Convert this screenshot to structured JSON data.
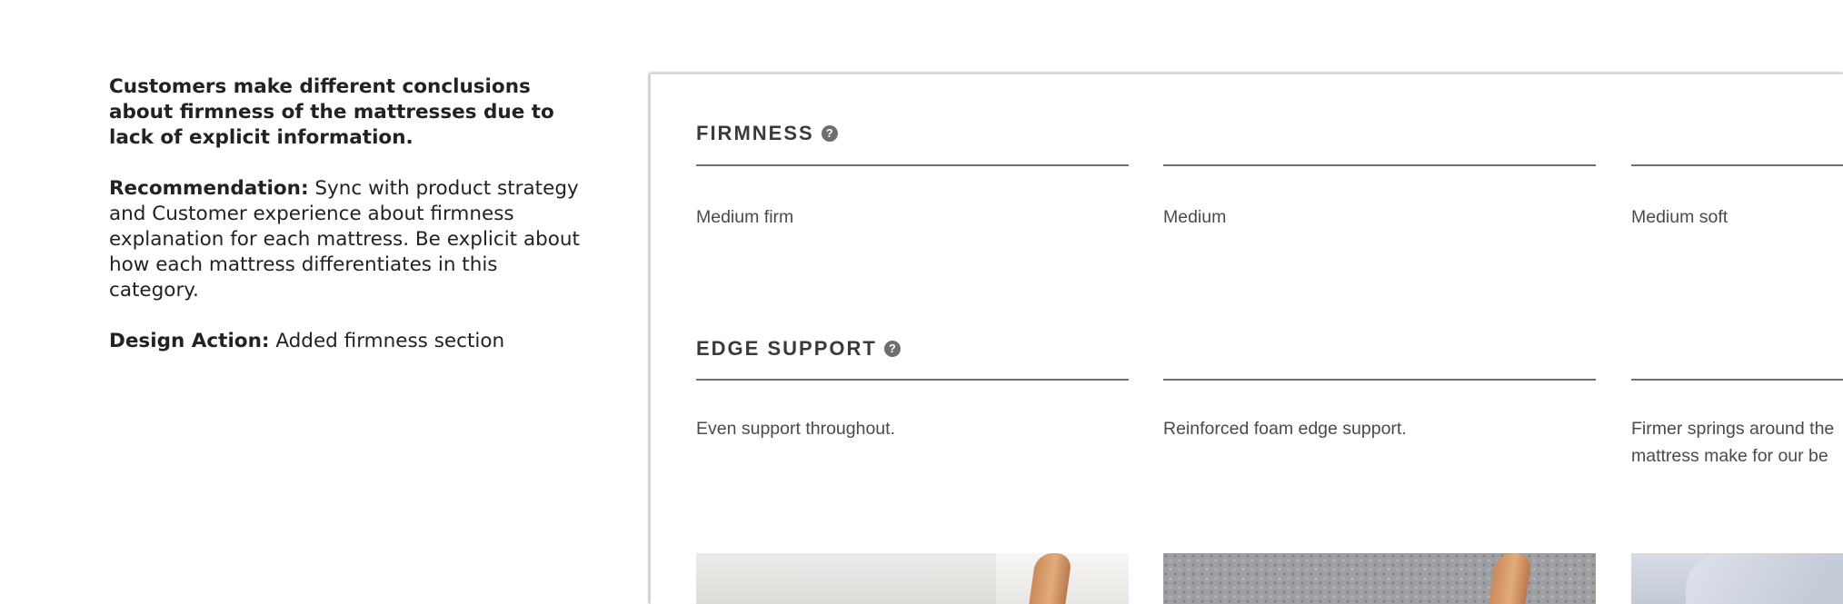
{
  "notes": {
    "finding": "Customers make different conclusions about firmness of the mattresses due to lack of explicit information.",
    "recommendation_label": "Recommendation:",
    "recommendation_text": " Sync with product strategy and Customer experience about firmness explanation for each mattress. Be explicit about how each mattress differentiates in this category.",
    "design_action_label": "Design Action:",
    "design_action_text": " Added firmness section"
  },
  "comparison": {
    "firmness": {
      "heading": "FIRMNESS",
      "help_glyph": "?",
      "values": [
        "Medium firm",
        "Medium",
        "Medium soft"
      ]
    },
    "edge_support": {
      "heading": "EDGE SUPPORT",
      "help_glyph": "?",
      "values": [
        "Even support throughout.",
        "Reinforced foam edge support.",
        "Firmer springs around the mattress make for our be"
      ]
    },
    "icons": [
      "help-icon"
    ]
  }
}
